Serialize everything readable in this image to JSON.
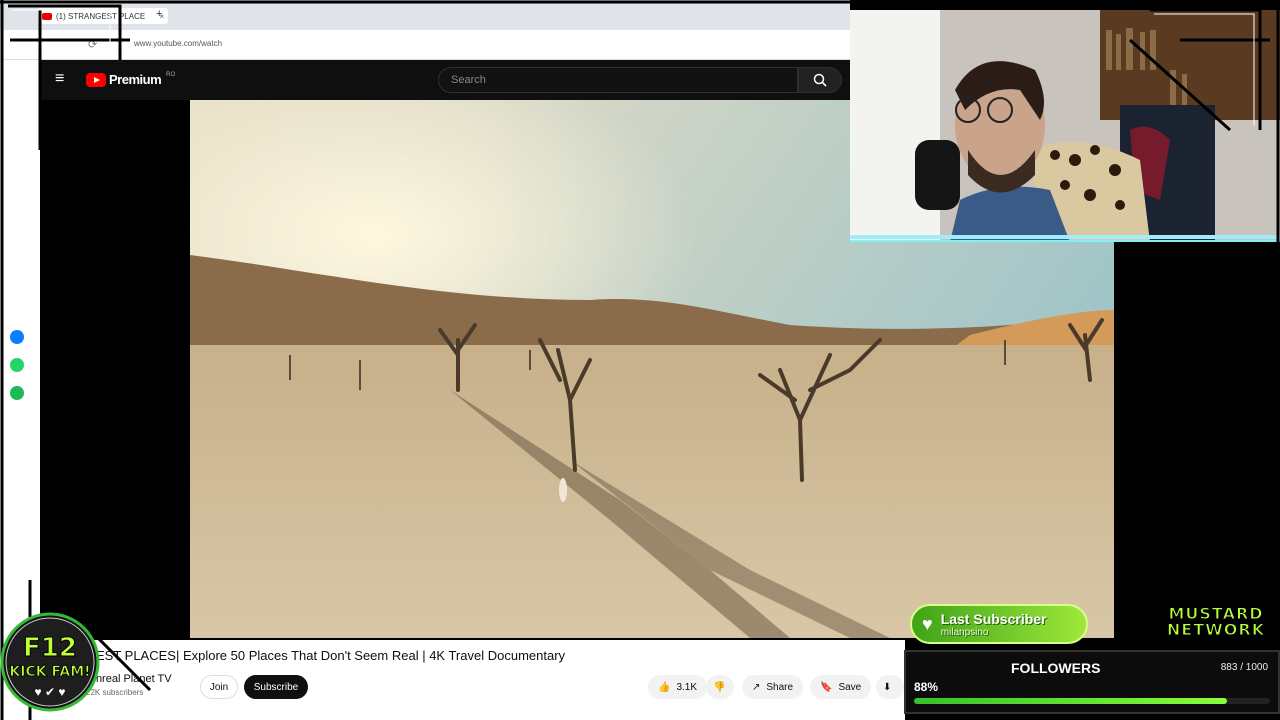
{
  "browser": {
    "tab_title": "(1) STRANGEST PLACE",
    "tab_close": "×",
    "new_tab": "+",
    "url": "www.youtube.com/watch"
  },
  "youtube": {
    "logo_text": "Premium",
    "logo_country": "RO",
    "search_placeholder": "Search",
    "accent": "#ff0000"
  },
  "video": {
    "title": "EST PLACES| Explore 50 Places That Don't Seem Real | 4K Travel Documentary",
    "channel": "Unreal Planet TV",
    "subscribers": "22K subscribers",
    "join_label": "Join",
    "subscribe_label": "Subscribe",
    "likes": "3.1K",
    "share_label": "Share",
    "save_label": "Save"
  },
  "overlay": {
    "kick_line1": "F12",
    "kick_line2": "KICK FAM!",
    "last_sub_title": "Last Subscriber",
    "last_sub_name": "milanpsino",
    "brand_line1": "MUSTARD",
    "brand_line2": "NETWORK",
    "followers_label": "FOLLOWERS",
    "followers_count": "883 / 1000",
    "followers_percent": "88%",
    "followers_progress": 0.88
  },
  "icons": {
    "side": [
      "messenger-icon",
      "whatsapp-icon",
      "spotify-icon"
    ],
    "colors": [
      "#0a7cff",
      "#25d366",
      "#1db954"
    ]
  }
}
